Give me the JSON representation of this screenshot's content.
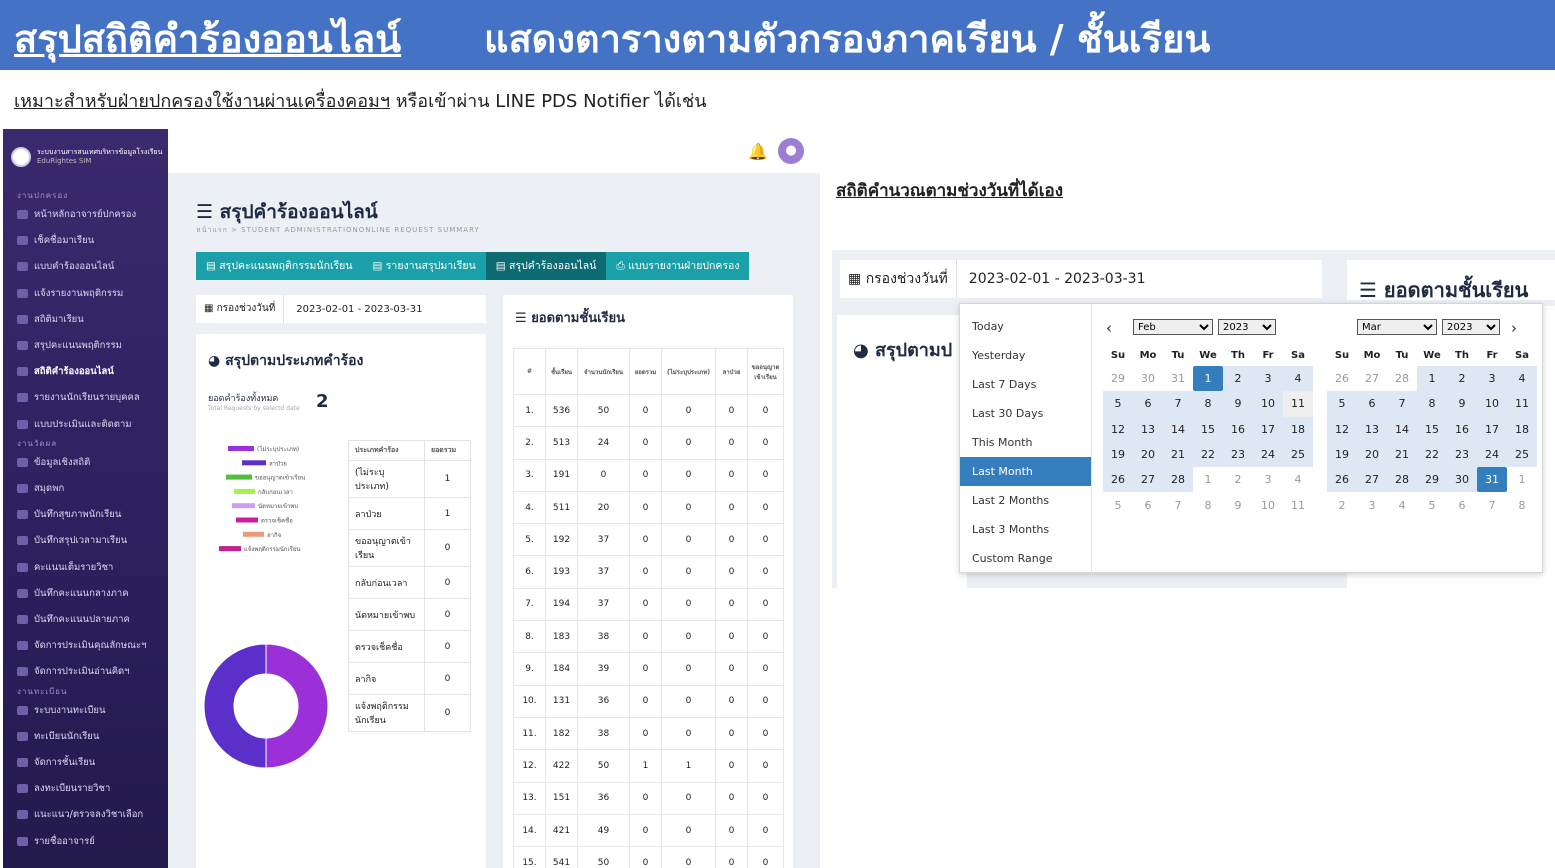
{
  "banner": {
    "title_underlined": "สรุปสถิติคำร้องออนไลน์",
    "title_rest": "แสดงตารางตามตัวกรองภาคเรียน / ชั้นเรียน"
  },
  "subtitle": {
    "underlined": "เหมาะสำหรับฝ่ายปกครองใช้งานผ่านเครื่องคอมฯ",
    "rest": " หรือเข้าผ่าน LINE PDS Notifier ได้เช่น"
  },
  "sidebar": {
    "brand_line1": "ระบบงานสารสนเทศบริหารข้อมูลโรงเรียน",
    "brand_line2": "EduRightes SIM",
    "sections": [
      "งานปกครอง",
      "งานวัดผล",
      "งานทะเบียน"
    ],
    "items_pk": [
      "หน้าหลักอาจารย์ปกครอง",
      "เช็คชื่อมาเรียน",
      "แบบคำร้องออนไลน์",
      "แจ้งรายงานพฤติกรรม",
      "สถิติมาเรียน",
      "สรุปคะแนนพฤติกรรม",
      "สถิติคำร้องออนไลน์",
      "รายงานนักเรียนรายบุคคล",
      "แบบประเมินและติดตาม"
    ],
    "items_wp": [
      "ข้อมูลเชิงสถิติ",
      "สมุดพก",
      "บันทึกสุขภาพนักเรียน",
      "บันทึกสรุปเวลามาเรียน",
      "คะแนนเต็มรายวิชา",
      "บันทึกคะแนนกลางภาค",
      "บันทึกคะแนนปลายภาค",
      "จัดการประเมินคุณลักษณะฯ",
      "จัดการประเมินอ่านคิดฯ"
    ],
    "items_tb": [
      "ระบบงานทะเบียน",
      "ทะเบียนนักเรียน",
      "จัดการชั้นเรียน",
      "ลงทะเบียนรายวิชา",
      "แนะแนว/ตรวจลงวิชาเลือก",
      "รายชื่ออาจารย์"
    ]
  },
  "page": {
    "title": "สรุปคำร้องออนไลน์",
    "breadcrumb": "หน้าแรก > STUDENT ADMINISTRATIONONLINE REQUEST SUMMARY",
    "tabs": [
      "สรุปคะแนนพฤติกรรมนักเรียน",
      "รายงานสรุปมาเรียน",
      "สรุปคำร้องออนไลน์",
      "แบบรายงานฝ่ายปกครอง"
    ],
    "date_label": "กรองช่วงวันที่",
    "date_value": "2023-02-01 - 2023-03-31",
    "type_card_title": "สรุปตามประเภทคำร้อง",
    "total_label": "ยอดคำร้องทั้งหมด",
    "total_sub": "Total Requests by selectd date",
    "total_value": "2",
    "grade_card_title": "ยอดตามชั้นเรียน"
  },
  "type_table": {
    "headers": [
      "ประเภทคำร้อง",
      "ยอดรวม"
    ],
    "rows": [
      [
        "(ไม่ระบุประเภท)",
        "1"
      ],
      [
        "ลาป่วย",
        "1"
      ],
      [
        "ขออนุญาตเข้าเรียน",
        "0"
      ],
      [
        "กลับก่อนเวลา",
        "0"
      ],
      [
        "นัดหมายเข้าพบ",
        "0"
      ],
      [
        "ตรวจเช็คชื่อ",
        "0"
      ],
      [
        "ลากิจ",
        "0"
      ],
      [
        "แจ้งพฤติกรรมนักเรียน",
        "0"
      ]
    ]
  },
  "grade_table": {
    "headers": [
      "#",
      "ชั้นเรียน",
      "จำนวนนักเรียน",
      "ยอดรวม",
      "(ไม่ระบุประเภท)",
      "ลาป่วย",
      "ขออนุญาตเข้าเรียน"
    ],
    "rows": [
      [
        "1.",
        "536",
        "50",
        "0",
        "0",
        "0",
        "0"
      ],
      [
        "2.",
        "513",
        "24",
        "0",
        "0",
        "0",
        "0"
      ],
      [
        "3.",
        "191",
        "0",
        "0",
        "0",
        "0",
        "0"
      ],
      [
        "4.",
        "511",
        "20",
        "0",
        "0",
        "0",
        "0"
      ],
      [
        "5.",
        "192",
        "37",
        "0",
        "0",
        "0",
        "0"
      ],
      [
        "6.",
        "193",
        "37",
        "0",
        "0",
        "0",
        "0"
      ],
      [
        "7.",
        "194",
        "37",
        "0",
        "0",
        "0",
        "0"
      ],
      [
        "8.",
        "183",
        "38",
        "0",
        "0",
        "0",
        "0"
      ],
      [
        "9.",
        "184",
        "39",
        "0",
        "0",
        "0",
        "0"
      ],
      [
        "10.",
        "131",
        "36",
        "0",
        "0",
        "0",
        "0"
      ],
      [
        "11.",
        "182",
        "38",
        "0",
        "0",
        "0",
        "0"
      ],
      [
        "12.",
        "422",
        "50",
        "1",
        "1",
        "0",
        "0"
      ],
      [
        "13.",
        "151",
        "36",
        "0",
        "0",
        "0",
        "0"
      ],
      [
        "14.",
        "421",
        "49",
        "0",
        "0",
        "0",
        "0"
      ],
      [
        "15.",
        "541",
        "50",
        "0",
        "0",
        "0",
        "0"
      ]
    ]
  },
  "chart_data": [
    {
      "type": "bar",
      "orientation": "horizontal",
      "categories": [
        "(ไม่ระบุประเภท)",
        "ลาป่วย",
        "ขออนุญาตเข้าเรียน",
        "กลับก่อนเวลา",
        "นัดหมายเข้าพบ",
        "ตรวจเช็คชื่อ",
        "ลากิจ",
        "แจ้งพฤติกรรมนักเรียน"
      ],
      "colors": [
        "#9b30d9",
        "#5b2fc9",
        "#4fbf3a",
        "#a6ef55",
        "#c9a0f0",
        "#c91fa0",
        "#e89c7a",
        "#c2208a"
      ]
    },
    {
      "type": "pie",
      "donut": true,
      "labels": [
        "(ไม่ระบุประเภท)",
        "ลาป่วย"
      ],
      "values": [
        1,
        1
      ],
      "colors": [
        "#9b30d9",
        "#5b2fc9"
      ]
    }
  ],
  "section2": {
    "title": "สถิติคำนวณตามช่วงวันที่ได้เอง",
    "date_label": "กรองช่วงวันที่",
    "date_value": "2023-02-01 - 2023-03-31",
    "grade_title": "ยอดตามชั้นเรียน",
    "card_title": "สรุปตามป"
  },
  "picker": {
    "ranges": [
      "Today",
      "Yesterday",
      "Last 7 Days",
      "Last 30 Days",
      "This Month",
      "Last Month",
      "Last 2 Months",
      "Last 3 Months",
      "Custom Range"
    ],
    "active_range": "Last Month",
    "weekdays": [
      "Su",
      "Mo",
      "Tu",
      "We",
      "Th",
      "Fr",
      "Sa"
    ],
    "left": {
      "month": "Feb",
      "year": "2023",
      "start_date": "1"
    },
    "right": {
      "month": "Mar",
      "year": "2023",
      "end_date": "31"
    },
    "prev_icon": "chevron-left-icon",
    "next_icon": "chevron-right-icon"
  },
  "colors": {
    "banner": "#4472c4",
    "sidebar": "#2b1f5c",
    "tab": "#1aa0a8",
    "tab_active": "#0d6b72",
    "range_selected": "#357ebd",
    "in_range": "#dde8f4"
  }
}
